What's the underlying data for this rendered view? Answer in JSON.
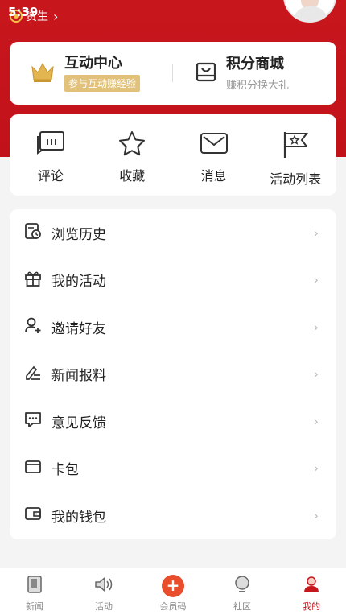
{
  "status": {
    "time": "5:39"
  },
  "profile": {
    "level_label": "资生"
  },
  "top_card": {
    "interaction": {
      "title": "互动中心",
      "badge": "参与互动赚经验"
    },
    "mall": {
      "title": "积分商城",
      "subtitle": "赚积分换大礼"
    }
  },
  "quick_actions": [
    {
      "label": "评论",
      "icon": "comment-icon"
    },
    {
      "label": "收藏",
      "icon": "star-icon"
    },
    {
      "label": "消息",
      "icon": "mail-icon"
    },
    {
      "label": "活动列表",
      "icon": "flag-icon"
    }
  ],
  "menu": [
    {
      "label": "浏览历史",
      "icon": "history-icon"
    },
    {
      "label": "我的活动",
      "icon": "gift-icon"
    },
    {
      "label": "邀请好友",
      "icon": "add-user-icon"
    },
    {
      "label": "新闻报料",
      "icon": "pen-icon"
    },
    {
      "label": "意见反馈",
      "icon": "feedback-icon"
    },
    {
      "label": "卡包",
      "icon": "card-icon"
    },
    {
      "label": "我的钱包",
      "icon": "wallet-icon"
    }
  ],
  "tabs": [
    {
      "label": "新闻",
      "icon": "news-icon"
    },
    {
      "label": "活动",
      "icon": "speaker-icon"
    },
    {
      "label": "会员码",
      "icon": "plus-icon"
    },
    {
      "label": "社区",
      "icon": "bulb-icon"
    },
    {
      "label": "我的",
      "icon": "user-icon"
    }
  ],
  "colors": {
    "brand": "#c8161d",
    "badge": "#e2c27a",
    "center_button": "#e84d2c"
  }
}
